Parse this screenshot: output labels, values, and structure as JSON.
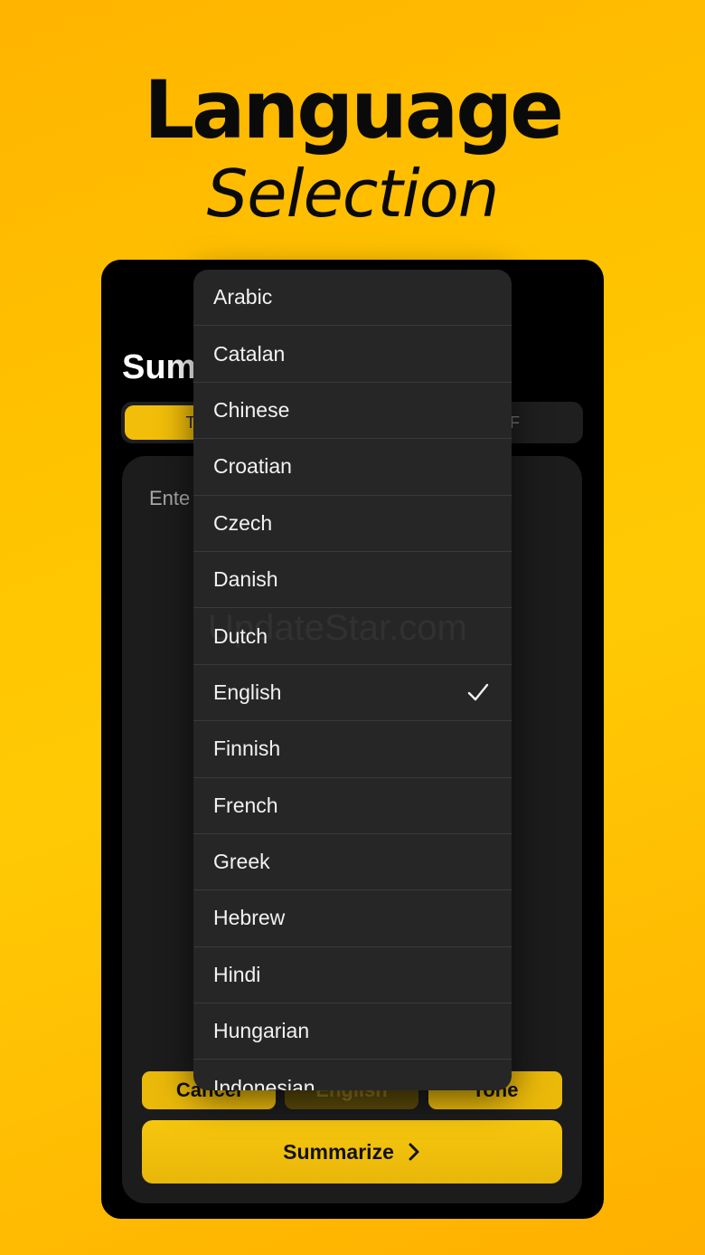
{
  "hero": {
    "title": "Language",
    "subtitle": "Selection"
  },
  "app": {
    "title": "Sum",
    "tabs": {
      "active": "Text",
      "right": "PDF"
    },
    "input_placeholder": "Ente",
    "chips": {
      "cancel": "Cancel",
      "language": "English",
      "tone": "Tone"
    },
    "summarize_label": "Summarize",
    "summarize_icon": "chevron-right-icon"
  },
  "language_menu": {
    "selected": "English",
    "check_icon": "checkmark-icon",
    "options": [
      "Arabic",
      "Catalan",
      "Chinese",
      "Croatian",
      "Czech",
      "Danish",
      "Dutch",
      "English",
      "Finnish",
      "French",
      "Greek",
      "Hebrew",
      "Hindi",
      "Hungarian",
      "Indonesian"
    ]
  },
  "watermark": "UpdateStar.com",
  "colors": {
    "accent": "#F2BE0A",
    "background": "#FFC400",
    "menu": "#262626"
  }
}
